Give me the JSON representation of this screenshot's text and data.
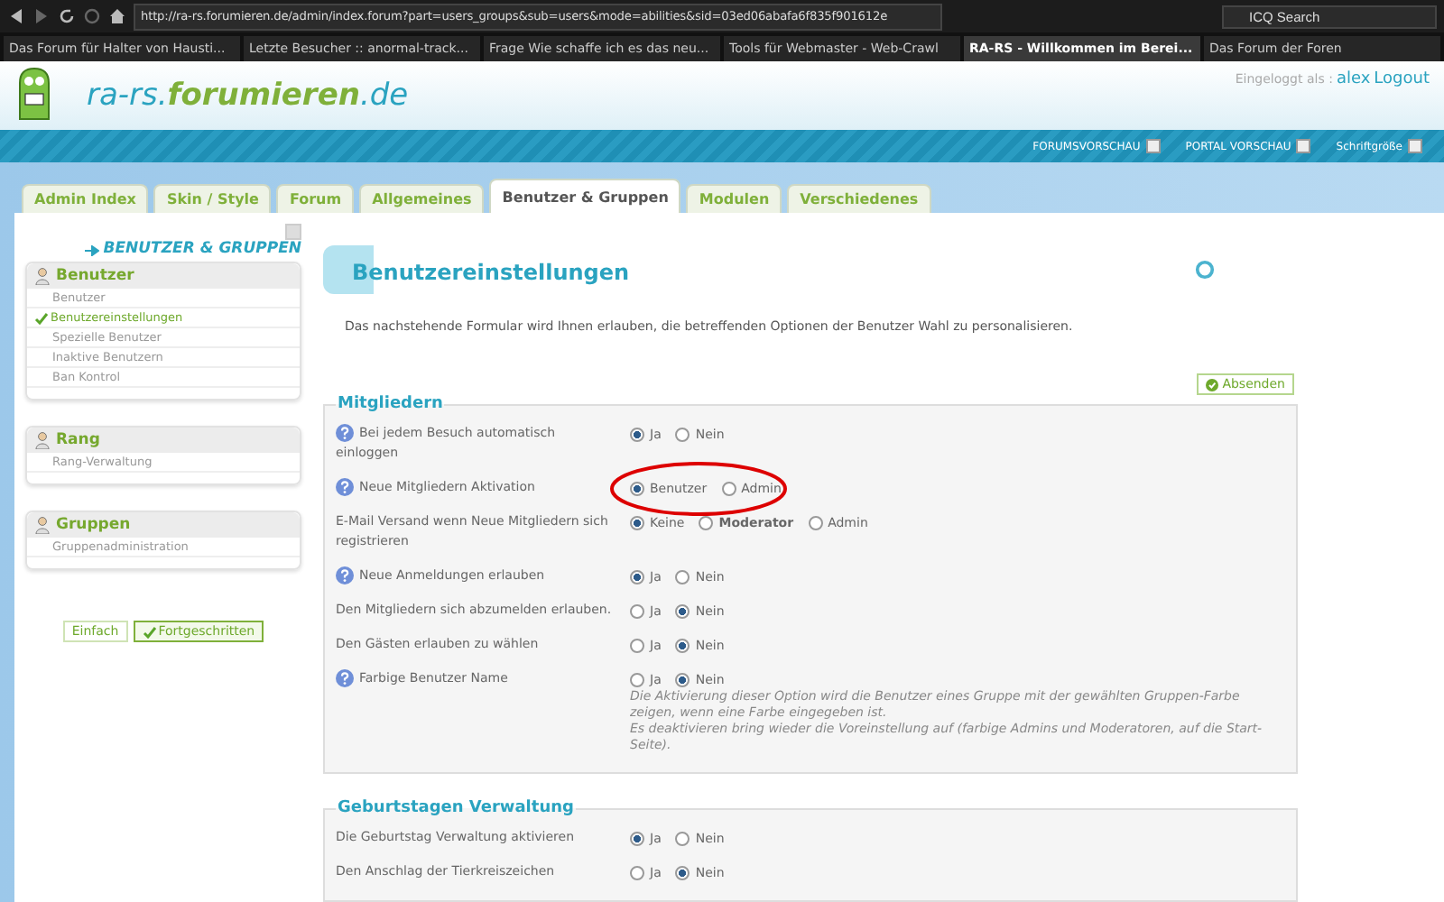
{
  "browser": {
    "url": "http://ra-rs.forumieren.de/admin/index.forum?part=users_groups&sub=users&mode=abilities&sid=03ed06abafa6f835f901612e",
    "search": {
      "placeholder": "ICQ Search"
    },
    "tabs": [
      {
        "label": "Das Forum für Halter von Hausti...",
        "selected": false
      },
      {
        "label": "Letzte Besucher :: anormal-track...",
        "selected": false
      },
      {
        "label": "Frage Wie schaffe ich es das neu...",
        "selected": false
      },
      {
        "label": "Tools für Webmaster - Web-Crawl",
        "selected": false
      },
      {
        "label": "RA-RS - Willkommen im Berei...",
        "selected": true
      },
      {
        "label": "Das Forum der Foren",
        "selected": false
      }
    ]
  },
  "header": {
    "site": {
      "prefix": "ra-rs.",
      "main": "forumieren",
      "suffix": ".de"
    },
    "login_label": "Eingeloggt als :",
    "user": "alex",
    "logout": "Logout",
    "links": [
      "FORUMSVORSCHAU",
      "PORTAL VORSCHAU",
      "Schriftgröße"
    ]
  },
  "nav_tabs": [
    {
      "label": "Admin Index",
      "selected": false
    },
    {
      "label": "Skin / Style",
      "selected": false
    },
    {
      "label": "Forum",
      "selected": false
    },
    {
      "label": "Allgemeines",
      "selected": false
    },
    {
      "label": "Benutzer & Gruppen",
      "selected": true
    },
    {
      "label": "Modulen",
      "selected": false
    },
    {
      "label": "Verschiedenes",
      "selected": false
    }
  ],
  "sidebar": {
    "title": "BENUTZER & GRUPPEN",
    "sections": [
      {
        "title": "Benutzer",
        "items": [
          {
            "label": "Benutzer",
            "selected": false
          },
          {
            "label": "Benutzereinstellungen",
            "selected": true
          },
          {
            "label": "Spezielle Benutzer",
            "selected": false
          },
          {
            "label": "Inaktive Benutzern",
            "selected": false
          },
          {
            "label": "Ban Kontrol",
            "selected": false
          }
        ]
      },
      {
        "title": "Rang",
        "items": [
          {
            "label": "Rang-Verwaltung",
            "selected": false
          }
        ]
      },
      {
        "title": "Gruppen",
        "items": [
          {
            "label": "Gruppenadministration",
            "selected": false
          }
        ]
      }
    ],
    "modes": [
      {
        "label": "Einfach",
        "selected": false
      },
      {
        "label": "Fortgeschritten",
        "selected": true
      }
    ]
  },
  "main": {
    "title": "Benutzereinstellungen",
    "description": "Das nachstehende Formular wird Ihnen erlauben, die betreffenden Optionen der Benutzer Wahl zu personalisieren.",
    "submit": "Absenden",
    "fieldsets": [
      {
        "legend": "Mitgliedern",
        "rows": [
          {
            "label": "Bei jedem Besuch automatisch einloggen",
            "help": true,
            "options": [
              {
                "label": "Ja",
                "selected": true
              },
              {
                "label": "Nein",
                "selected": false
              }
            ]
          },
          {
            "label": "Neue Mitgliedern Aktivation",
            "help": true,
            "circled": true,
            "options": [
              {
                "label": "Benutzer",
                "selected": true
              },
              {
                "label": "Admin",
                "selected": false
              }
            ]
          },
          {
            "label": "E-Mail Versand wenn Neue Mitgliedern sich registrieren",
            "help": false,
            "options": [
              {
                "label": "Keine",
                "selected": true
              },
              {
                "label": "Moderator",
                "selected": false,
                "bold": true
              },
              {
                "label": "Admin",
                "selected": false
              }
            ]
          },
          {
            "label": "Neue Anmeldungen erlauben",
            "help": true,
            "options": [
              {
                "label": "Ja",
                "selected": true
              },
              {
                "label": "Nein",
                "selected": false
              }
            ]
          },
          {
            "label": "Den Mitgliedern sich abzumelden erlauben.",
            "help": false,
            "options": [
              {
                "label": "Ja",
                "selected": false
              },
              {
                "label": "Nein",
                "selected": true
              }
            ]
          },
          {
            "label": "Den Gästen erlauben zu wählen",
            "help": false,
            "options": [
              {
                "label": "Ja",
                "selected": false
              },
              {
                "label": "Nein",
                "selected": true
              }
            ]
          },
          {
            "label": "Farbige Benutzer Name",
            "help": true,
            "options": [
              {
                "label": "Ja",
                "selected": false
              },
              {
                "label": "Nein",
                "selected": true
              }
            ],
            "note": [
              "Die Aktivierung dieser Option wird die Benutzer eines Gruppe mit der gewählten Gruppen-Farbe zeigen, wenn eine Farbe eingegeben ist.",
              "Es deaktivieren bring wieder die Voreinstellung auf (farbige Admins und Moderatoren, auf die Start-Seite)."
            ]
          }
        ]
      },
      {
        "legend": "Geburtstagen Verwaltung",
        "rows": [
          {
            "label": "Die Geburtstag Verwaltung aktivieren",
            "help": false,
            "options": [
              {
                "label": "Ja",
                "selected": true
              },
              {
                "label": "Nein",
                "selected": false
              }
            ]
          },
          {
            "label": "Den Anschlag der Tierkreiszeichen",
            "help": false,
            "options": [
              {
                "label": "Ja",
                "selected": false
              },
              {
                "label": "Nein",
                "selected": true
              }
            ]
          }
        ]
      }
    ]
  }
}
